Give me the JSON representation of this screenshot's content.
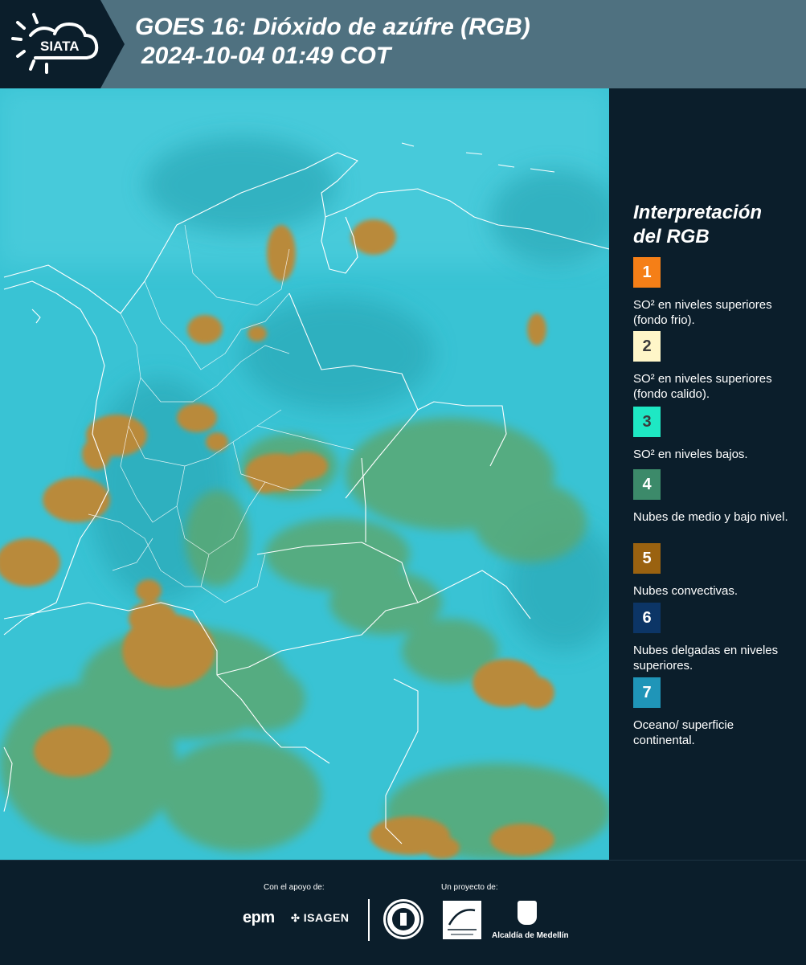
{
  "header": {
    "logo_text": "SIATA",
    "title_line1": "GOES 16: Dióxido de azúfre (RGB)",
    "title_line2": "2024-10-04 01:49 COT"
  },
  "legend": {
    "title_line1": "Interpretación",
    "title_line2": "del RGB",
    "items": [
      {
        "number": "1",
        "text": "SO² en niveles superiores (fondo frio).",
        "color": "#f57f17",
        "num_color": "#ffffff"
      },
      {
        "number": "2",
        "text": "SO² en niveles superiores (fondo calido).",
        "color": "#fff6c8",
        "num_color": "#3a3a3a"
      },
      {
        "number": "3",
        "text": "SO² en niveles bajos.",
        "color": "#1ee8c4",
        "num_color": "#3a3a3a"
      },
      {
        "number": "4",
        "text": "Nubes de medio y bajo nivel.",
        "color": "#3c8a6a",
        "num_color": "#ffffff"
      },
      {
        "number": "5",
        "text": "Nubes convectivas.",
        "color": "#9a6210",
        "num_color": "#ffffff"
      },
      {
        "number": "6",
        "text": "Nubes delgadas en niveles superiores.",
        "color": "#0c3566",
        "num_color": "#ffffff"
      },
      {
        "number": "7",
        "text": "Oceano/ superficie continental.",
        "color": "#1f95b8",
        "num_color": "#ffffff"
      }
    ]
  },
  "footer": {
    "support_label": "Con el apoyo de:",
    "project_label": "Un proyecto de:",
    "epm": "epm",
    "isagen": "ISAGEN",
    "alcaldia": "Alcaldía de Medellín"
  },
  "map": {
    "background_color": "#39c3d4",
    "convective_color": "#b98a3a",
    "midlevel_color": "#5aa873",
    "border_color": "#ffffff"
  }
}
